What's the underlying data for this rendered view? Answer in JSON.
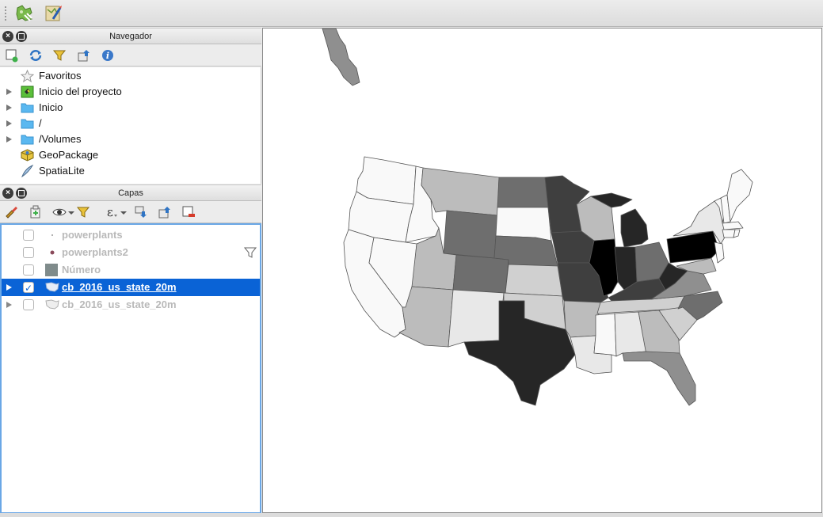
{
  "toolbar": {
    "icons": [
      "plugin-manager-icon",
      "style-manager-icon"
    ]
  },
  "browser_panel": {
    "title": "Navegador",
    "tools": [
      "add-selected-layers-icon",
      "refresh-icon",
      "filter-icon",
      "collapse-all-icon",
      "info-icon"
    ],
    "items": [
      {
        "label": "Favoritos",
        "icon": "star-icon",
        "expandable": false
      },
      {
        "label": "Inicio del proyecto",
        "icon": "project-home-icon",
        "expandable": true
      },
      {
        "label": "Inicio",
        "icon": "folder-icon",
        "expandable": true
      },
      {
        "label": "/",
        "icon": "folder-icon",
        "expandable": true
      },
      {
        "label": "/Volumes",
        "icon": "folder-icon",
        "expandable": true
      },
      {
        "label": "GeoPackage",
        "icon": "geopackage-icon",
        "expandable": false
      },
      {
        "label": "SpatiaLite",
        "icon": "spatialite-icon",
        "expandable": false
      }
    ]
  },
  "layers_panel": {
    "title": "Capas",
    "tools": [
      "style-icon",
      "add-group-icon",
      "eye-icon",
      "filter-legend-icon",
      "expression-filter-icon",
      "expand-all-icon",
      "collapse-all-icon",
      "remove-layer-icon"
    ],
    "layers": [
      {
        "name": "powerplants",
        "checked": false,
        "selected": false,
        "expandable": false
      },
      {
        "name": "powerplants2",
        "checked": false,
        "selected": false,
        "expandable": false,
        "filtered": true
      },
      {
        "name": "Número",
        "checked": false,
        "selected": false,
        "expandable": false
      },
      {
        "name": "cb_2016_us_state_20m",
        "checked": true,
        "selected": true,
        "expandable": true
      },
      {
        "name": "cb_2016_us_state_20m",
        "checked": false,
        "selected": false,
        "expandable": true
      }
    ]
  },
  "map": {
    "colors": {
      "white": "#f9f9f9",
      "light1": "#e8e8e8",
      "light2": "#d0d0d0",
      "mid1": "#bcbcbc",
      "mid2": "#8f8f8f",
      "dark1": "#6e6e6e",
      "dark2": "#3f3f3f",
      "dark3": "#262626",
      "black": "#000000"
    }
  }
}
